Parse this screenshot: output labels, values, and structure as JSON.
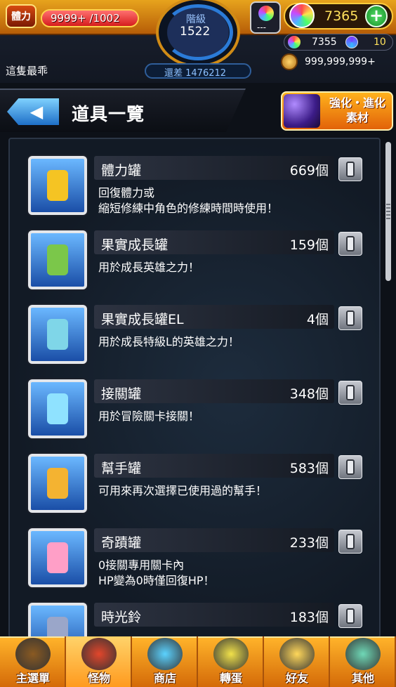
{
  "hud": {
    "stamina_icon_label": "體力",
    "stamina_text": "9999+ /1002",
    "stamina_fraction": 1.0,
    "rank_label": "階級",
    "rank_value": "1522",
    "rank_next_text": "還差 1476212",
    "player_name": "這隻最乖",
    "orb_small_label": "---",
    "orb_count": "7365",
    "plus_label": "+",
    "sub_orb_count": "7355",
    "swirl_count": "10",
    "coin_count": "999,999,999+"
  },
  "header": {
    "back_label": "◀",
    "title": "道具一覽",
    "material_button": "強化・進化\n素材"
  },
  "items": [
    {
      "name": "體力罐",
      "qty": "669個",
      "desc": "回復體力或\n縮短修練中角色的修練時間時使用！",
      "icon_color": "#f5c423",
      "icon": "stamina-can-icon"
    },
    {
      "name": "果實成長罐",
      "qty": "159個",
      "desc": "用於成長英雄之力！",
      "icon_color": "#7bc74a",
      "icon": "fruit-bottle-icon"
    },
    {
      "name": "果實成長罐EL",
      "qty": "4個",
      "desc": "用於成長特級L的英雄之力！",
      "icon_color": "#7fd6e8",
      "icon": "fruit-bottle-el-icon"
    },
    {
      "name": "接關罐",
      "qty": "348個",
      "desc": "用於冒險關卡接關！",
      "icon_color": "#8fe2ff",
      "icon": "continue-jar-icon"
    },
    {
      "name": "幫手罐",
      "qty": "583個",
      "desc": "可用來再次選擇已使用過的幫手！",
      "icon_color": "#f4b331",
      "icon": "helper-jar-icon"
    },
    {
      "name": "奇蹟罐",
      "qty": "233個",
      "desc": "0接關專用關卡內\nHP變為0時僅回復HP！",
      "icon_color": "#ff9fc7",
      "icon": "miracle-jar-icon"
    },
    {
      "name": "時光鈴",
      "qty": "183個",
      "desc": "",
      "icon_color": "#9aa6c9",
      "icon": "time-bell-icon"
    }
  ],
  "nav": [
    {
      "label": "主選單",
      "icon": "main-menu-icon",
      "color": "#8a5a22"
    },
    {
      "label": "怪物",
      "icon": "monster-icon",
      "color": "#e2462b"
    },
    {
      "label": "商店",
      "icon": "shop-icon",
      "color": "#5bd2ff"
    },
    {
      "label": "轉蛋",
      "icon": "gacha-icon",
      "color": "#f1e14a"
    },
    {
      "label": "好友",
      "icon": "friends-icon",
      "color": "#ffd75a"
    },
    {
      "label": "其他",
      "icon": "other-icon",
      "color": "#6fd8b6"
    }
  ]
}
